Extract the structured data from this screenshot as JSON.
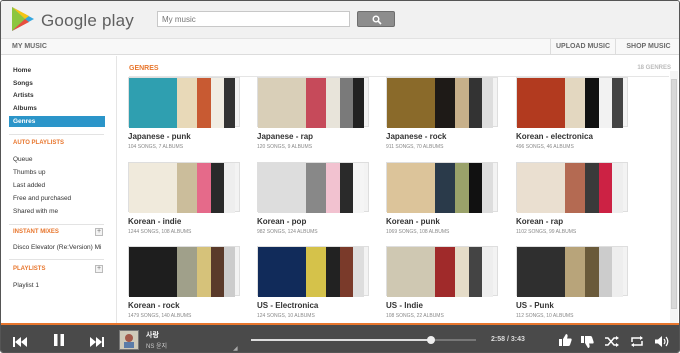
{
  "header": {
    "logo_text": "Google play",
    "search_placeholder": "My music"
  },
  "nav": {
    "my_music": "MY MUSIC",
    "upload_music": "UPLOAD MUSIC",
    "shop_music": "SHOP MUSIC"
  },
  "sidebar": {
    "items": [
      "Home",
      "Songs",
      "Artists",
      "Albums",
      "Genres"
    ],
    "selected": "Genres",
    "auto_playlists_heading": "AUTO PLAYLISTS",
    "auto_playlists": [
      "Queue",
      "Thumbs up",
      "Last added",
      "Free and purchased",
      "Shared with me"
    ],
    "instant_mixes_heading": "INSTANT MIXES",
    "instant_mixes": [
      "Disco Elevator (Re:Version) Mi"
    ],
    "playlists_heading": "PLAYLISTS",
    "playlists": [
      "Playlist 1"
    ]
  },
  "main": {
    "title": "GENRES",
    "count": "18 GENRES",
    "genres": [
      {
        "name": "Japanese - punk",
        "info": "104 SONGS, 7 ALBUMS"
      },
      {
        "name": "Japanese - rap",
        "info": "120 SONGS, 9 ALBUMS"
      },
      {
        "name": "Japanese - rock",
        "info": "911 SONGS, 70 ALBUMS"
      },
      {
        "name": "Korean - electronica",
        "info": "496 SONGS, 46 ALBUMS"
      },
      {
        "name": "Korean - indie",
        "info": "1244 SONGS, 108 ALBUMS"
      },
      {
        "name": "Korean - pop",
        "info": "982 SONGS, 124 ALBUMS"
      },
      {
        "name": "Korean - punk",
        "info": "1069 SONGS, 108 ALBUMS"
      },
      {
        "name": "Korean - rap",
        "info": "1102 SONGS, 99 ALBUMS"
      },
      {
        "name": "Korean - rock",
        "info": "1479 SONGS, 140 ALBUMS"
      },
      {
        "name": "US - Electronica",
        "info": "124 SONGS, 10 ALBUMS"
      },
      {
        "name": "US - Indie",
        "info": "108 SONGS, 22 ALBUMS"
      },
      {
        "name": "US - Punk",
        "info": "112 SONGS, 10 ALBUMS"
      }
    ]
  },
  "player": {
    "song_title": "사랑",
    "artist": "NS 윤지",
    "time": "2:58 / 3:43",
    "progress": 0.8,
    "icons": [
      "previous-icon",
      "pause-icon",
      "next-icon",
      "expand-icon",
      "thumbs-up-icon",
      "thumbs-down-icon",
      "shuffle-icon",
      "repeat-icon",
      "volume-icon"
    ]
  },
  "colors": {
    "accent": "#e8762d",
    "selected_bg": "#2b95c9",
    "player_bg": "#4a4a4a"
  }
}
